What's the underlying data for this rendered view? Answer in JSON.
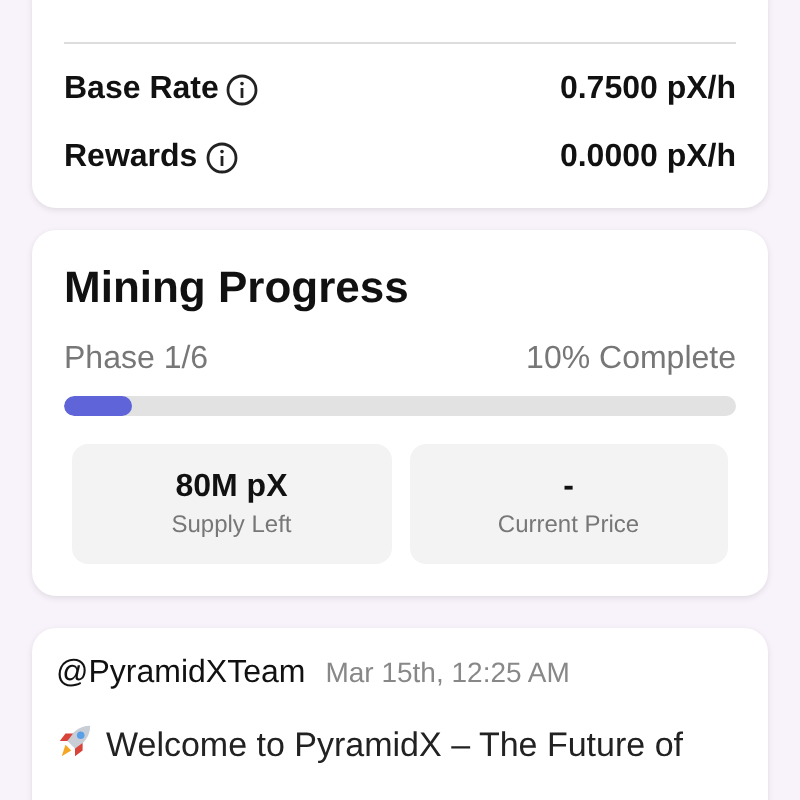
{
  "rates": [
    {
      "label": "Base Rate",
      "value": "0.7500 pX/h"
    },
    {
      "label": "Rewards",
      "value": "0.0000 pX/h"
    }
  ],
  "progress": {
    "title": "Mining Progress",
    "phase": "Phase 1/6",
    "complete": "10% Complete",
    "level": 0.1,
    "stats": [
      {
        "value": "80M pX",
        "label": "Supply Left"
      },
      {
        "value": "-",
        "label": "Current Price"
      }
    ]
  },
  "post": {
    "author": "@PyramidXTeam",
    "time": "Mar 15th, 12:25 AM",
    "text": "Welcome to PyramidX – The Future of"
  }
}
